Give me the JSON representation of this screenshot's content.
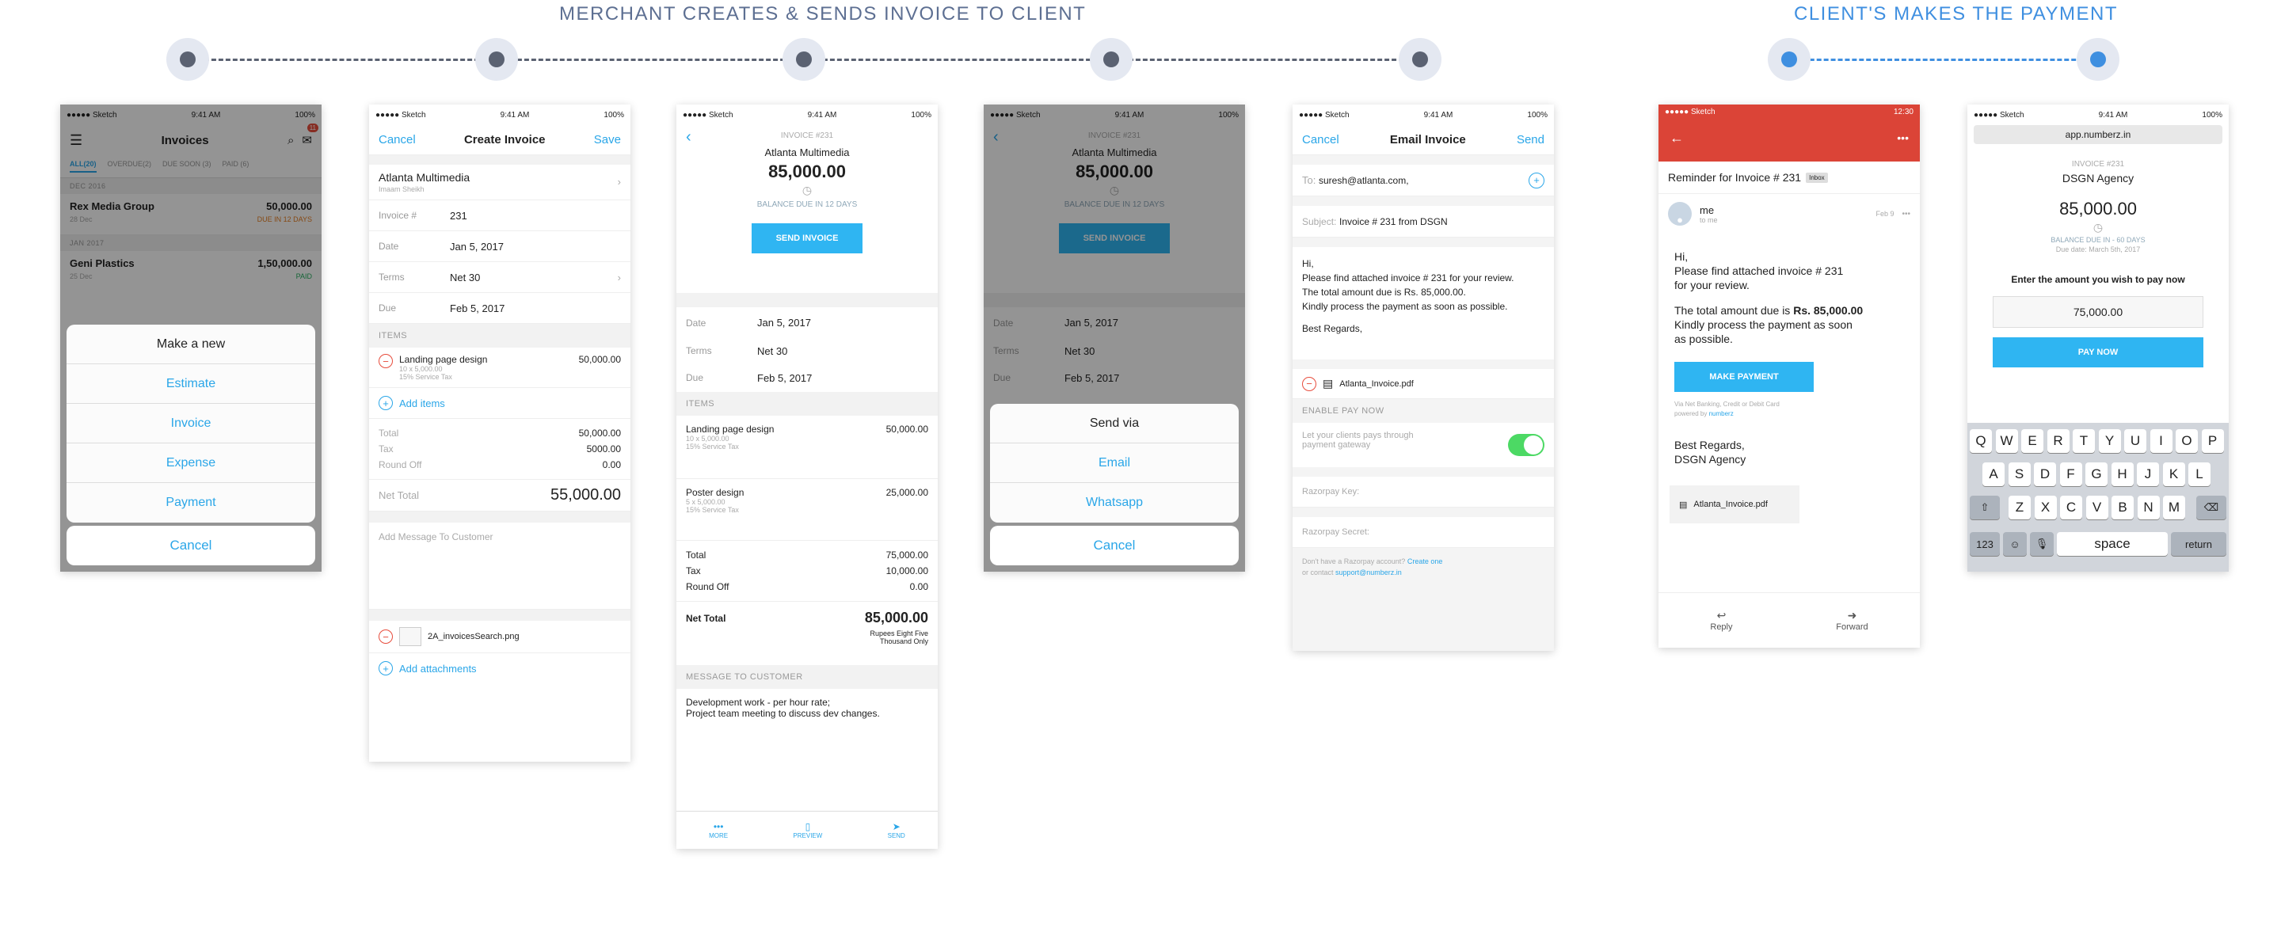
{
  "flow": {
    "merchant_heading": "MERCHANT CREATES & SENDS INVOICE TO CLIENT",
    "client_heading": "CLIENT'S MAKES THE PAYMENT"
  },
  "status": {
    "carrier": "●●●●● Sketch",
    "time": "9:41 AM",
    "battery": "100%",
    "android_time": "12:30"
  },
  "s1": {
    "title": "Invoices",
    "badge": "11",
    "tabs": [
      "ALL(20)",
      "OVERDUE(2)",
      "DUE SOON (3)",
      "PAID (6)"
    ],
    "group1": "DEC 2016",
    "item1": {
      "name": "Rex Media Group",
      "date": "28 Dec",
      "amount": "50,000.00",
      "status": "DUE IN 12 DAYS"
    },
    "group2": "JAN 2017",
    "item2": {
      "name": "Geni Plastics",
      "date": "25 Dec",
      "amount": "1,50,000.00",
      "status": "PAID"
    },
    "sheet_title": "Make a new",
    "options": [
      "Estimate",
      "Invoice",
      "Expense",
      "Payment"
    ],
    "cancel": "Cancel"
  },
  "s2": {
    "cancel": "Cancel",
    "title": "Create Invoice",
    "save": "Save",
    "client": "Atlanta Multimedia",
    "contact": "Imaam Sheikh",
    "inv_label": "Invoice #",
    "inv_value": "231",
    "date_label": "Date",
    "date_value": "Jan 5, 2017",
    "terms_label": "Terms",
    "terms_value": "Net 30",
    "due_label": "Due",
    "due_value": "Feb 5, 2017",
    "items_header": "ITEMS",
    "item_name": "Landing page design",
    "item_amount": "50,000.00",
    "item_qty": "10 x 5,000.00",
    "item_tax": "15% Service Tax",
    "add_items": "Add items",
    "total_label": "Total",
    "total_value": "50,000.00",
    "tax_label": "Tax",
    "tax_value": "5000.00",
    "round_label": "Round Off",
    "round_value": "0.00",
    "net_label": "Net Total",
    "net_value": "55,000.00",
    "message_placeholder": "Add Message To Customer",
    "attachment": "2A_invoicesSearch.png",
    "add_attachments": "Add attachments"
  },
  "s3": {
    "invoice_no": "INVOICE #231",
    "client": "Atlanta Multimedia",
    "amount": "85,000.00",
    "due_text": "BALANCE DUE IN 12 DAYS",
    "send_btn": "SEND INVOICE",
    "date_label": "Date",
    "date_value": "Jan 5, 2017",
    "terms_label": "Terms",
    "terms_value": "Net 30",
    "due_label": "Due",
    "due_value": "Feb 5, 2017",
    "items_header": "ITEMS",
    "item1": {
      "name": "Landing page design",
      "amount": "50,000.00",
      "qty": "10 x 5,000.00",
      "tax": "15% Service Tax"
    },
    "item2": {
      "name": "Poster design",
      "amount": "25,000.00",
      "qty": "5 x 5,000.00",
      "tax": "15% Service Tax"
    },
    "total_label": "Total",
    "total_value": "75,000.00",
    "tax_label": "Tax",
    "tax_value": "10,000.00",
    "round_label": "Round Off",
    "round_value": "0.00",
    "net_label": "Net Total",
    "net_value": "85,000.00",
    "words_line1": "Rupees Eight Five",
    "words_line2": "Thousand Only",
    "msg_header": "MESSAGE TO CUSTOMER",
    "msg_line1": "Development work - per hour rate;",
    "msg_line2": "Project team meeting to discuss dev changes.",
    "tab_more": "MORE",
    "tab_preview": "PREVIEW",
    "tab_send": "SEND"
  },
  "s4": {
    "invoice_no": "INVOICE #231",
    "client": "Atlanta Multimedia",
    "amount": "85,000.00",
    "due_text": "BALANCE DUE IN 12 DAYS",
    "send_btn": "SEND INVOICE",
    "date_label": "Date",
    "date_value": "Jan 5, 2017",
    "terms_label": "Terms",
    "terms_value": "Net 30",
    "due_label": "Due",
    "due_value": "Feb 5, 2017",
    "sheet_title": "Send via",
    "options": [
      "Email",
      "Whatsapp"
    ],
    "cancel": "Cancel"
  },
  "s5": {
    "cancel": "Cancel",
    "title": "Email Invoice",
    "send": "Send",
    "to_label": "To:",
    "to_value": "suresh@atlanta.com,",
    "subject_label": "Subject:",
    "subject_value": "Invoice # 231 from DSGN",
    "body": [
      "Hi,",
      "Please find attached invoice # 231 for your review.",
      "The total amount due is Rs. 85,000.00.",
      "Kindly process the payment as soon as possible.",
      "",
      "Best Regards,"
    ],
    "attachment": "Atlanta_Invoice.pdf",
    "enable_header": "ENABLE PAY NOW",
    "enable_text1": "Let your clients pays through",
    "enable_text2": "payment gateway",
    "key_placeholder": "Razorpay Key:",
    "secret_placeholder": "Razorpay Secret:",
    "footer1": "Don't have a Razorpay account?",
    "footer1_link": "Create one",
    "footer2": "or contact",
    "footer2_link": "support@numberz.in"
  },
  "s6": {
    "subject": "Reminder for Invoice # 231",
    "inbox": "Inbox",
    "sender": "me",
    "to": "to me",
    "date": "Feb 9",
    "line1": "Hi,",
    "line2": "Please find attached invoice # 231",
    "line3": "for your review.",
    "line4_pre": "The total amount due is ",
    "line4_bold": "Rs. 85,000.00",
    "line5": "Kindly process the payment as soon",
    "line6": "as possible.",
    "pay_btn": "MAKE PAYMENT",
    "via1": "Via Net Banking, Credit or Debit Card",
    "via2": "powered by",
    "via2_link": "numberz",
    "regards1": "Best Regards,",
    "regards2": "DSGN Agency",
    "attachment": "Atlanta_Invoice.pdf",
    "reply": "Reply",
    "forward": "Forward"
  },
  "s7": {
    "url": "app.numberz.in",
    "invoice_no": "INVOICE #231",
    "company": "DSGN Agency",
    "amount": "85,000.00",
    "due_text": "BALANCE DUE IN - 60 DAYS",
    "due_date": "Due date: March 5th, 2017",
    "prompt": "Enter the amount you wish to pay now",
    "input_value": "75,000.00",
    "pay_btn": "PAY NOW",
    "row1": [
      "Q",
      "W",
      "E",
      "R",
      "T",
      "Y",
      "U",
      "I",
      "O",
      "P"
    ],
    "row2": [
      "A",
      "S",
      "D",
      "F",
      "G",
      "H",
      "J",
      "K",
      "L"
    ],
    "row3": [
      "Z",
      "X",
      "C",
      "V",
      "B",
      "N",
      "M"
    ],
    "k123": "123",
    "space": "space",
    "return": "return"
  },
  "colors": {
    "accent": "#2aa6e8",
    "button": "#2fb5f2",
    "gmail_red": "#db4437",
    "toggle_on": "#4cd964",
    "connector": "#5b6272",
    "client_connector": "#3f8fe0"
  }
}
